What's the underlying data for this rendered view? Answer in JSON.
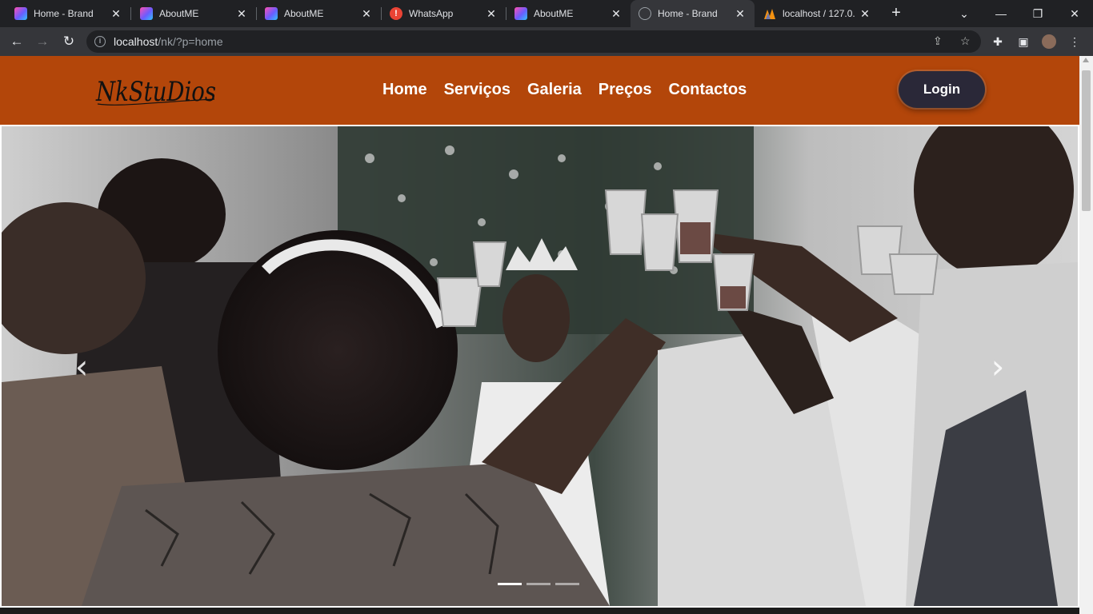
{
  "browser": {
    "tabs": [
      {
        "title": "Home - Brand",
        "favicon": "brand-gradient-icon",
        "active": false
      },
      {
        "title": "AboutME",
        "favicon": "brand-gradient-icon",
        "active": false
      },
      {
        "title": "AboutME",
        "favicon": "brand-gradient-icon",
        "active": false
      },
      {
        "title": "WhatsApp",
        "favicon": "alert-icon",
        "active": false
      },
      {
        "title": "AboutME",
        "favicon": "brand-gradient-icon",
        "active": false
      },
      {
        "title": "Home - Brand",
        "favicon": "globe-icon",
        "active": true
      },
      {
        "title": "localhost / 127.0.",
        "favicon": "phpmyadmin-icon",
        "active": false
      }
    ],
    "address": {
      "host": "localhost",
      "path": "/nk/?p=home"
    }
  },
  "site": {
    "logo_text": "NkStuDios",
    "nav": [
      "Home",
      "Serviços",
      "Galeria",
      "Preços",
      "Contactos"
    ],
    "login_label": "Login",
    "colors": {
      "header_bg": "#b3460a",
      "login_bg": "#2a2838"
    }
  },
  "carousel": {
    "prev_icon": "chevron-left-icon",
    "next_icon": "chevron-right-icon",
    "slides": 3,
    "active_slide": 1,
    "image": "wedding-toast-photo"
  }
}
